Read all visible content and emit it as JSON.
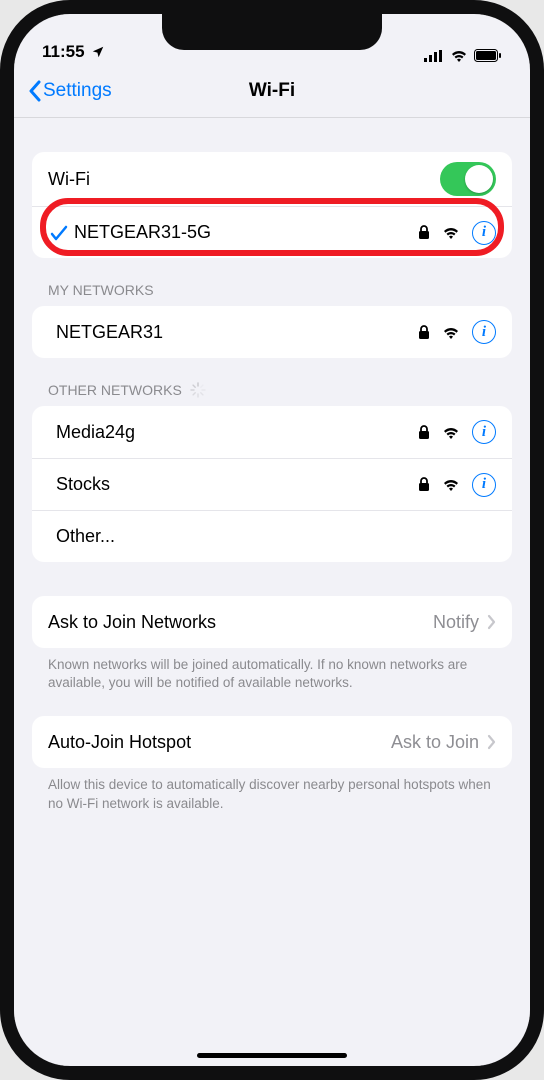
{
  "status": {
    "time": "11:55"
  },
  "nav": {
    "back_label": "Settings",
    "title": "Wi-Fi"
  },
  "wifi": {
    "toggle_label": "Wi-Fi",
    "enabled": true,
    "connected_network": "NETGEAR31-5G"
  },
  "sections": {
    "my_networks_header": "MY NETWORKS",
    "my_networks": [
      {
        "name": "NETGEAR31",
        "secured": true
      }
    ],
    "other_networks_header": "OTHER NETWORKS",
    "other_networks": [
      {
        "name": "Media24g",
        "secured": true
      },
      {
        "name": "Stocks",
        "secured": true
      }
    ],
    "other_label": "Other..."
  },
  "ask_to_join": {
    "label": "Ask to Join Networks",
    "value": "Notify",
    "footer": "Known networks will be joined automatically. If no known networks are available, you will be notified of available networks."
  },
  "auto_join": {
    "label": "Auto-Join Hotspot",
    "value": "Ask to Join",
    "footer": "Allow this device to automatically discover nearby personal hotspots when no Wi-Fi network is available."
  },
  "icons": {
    "info": "i"
  }
}
